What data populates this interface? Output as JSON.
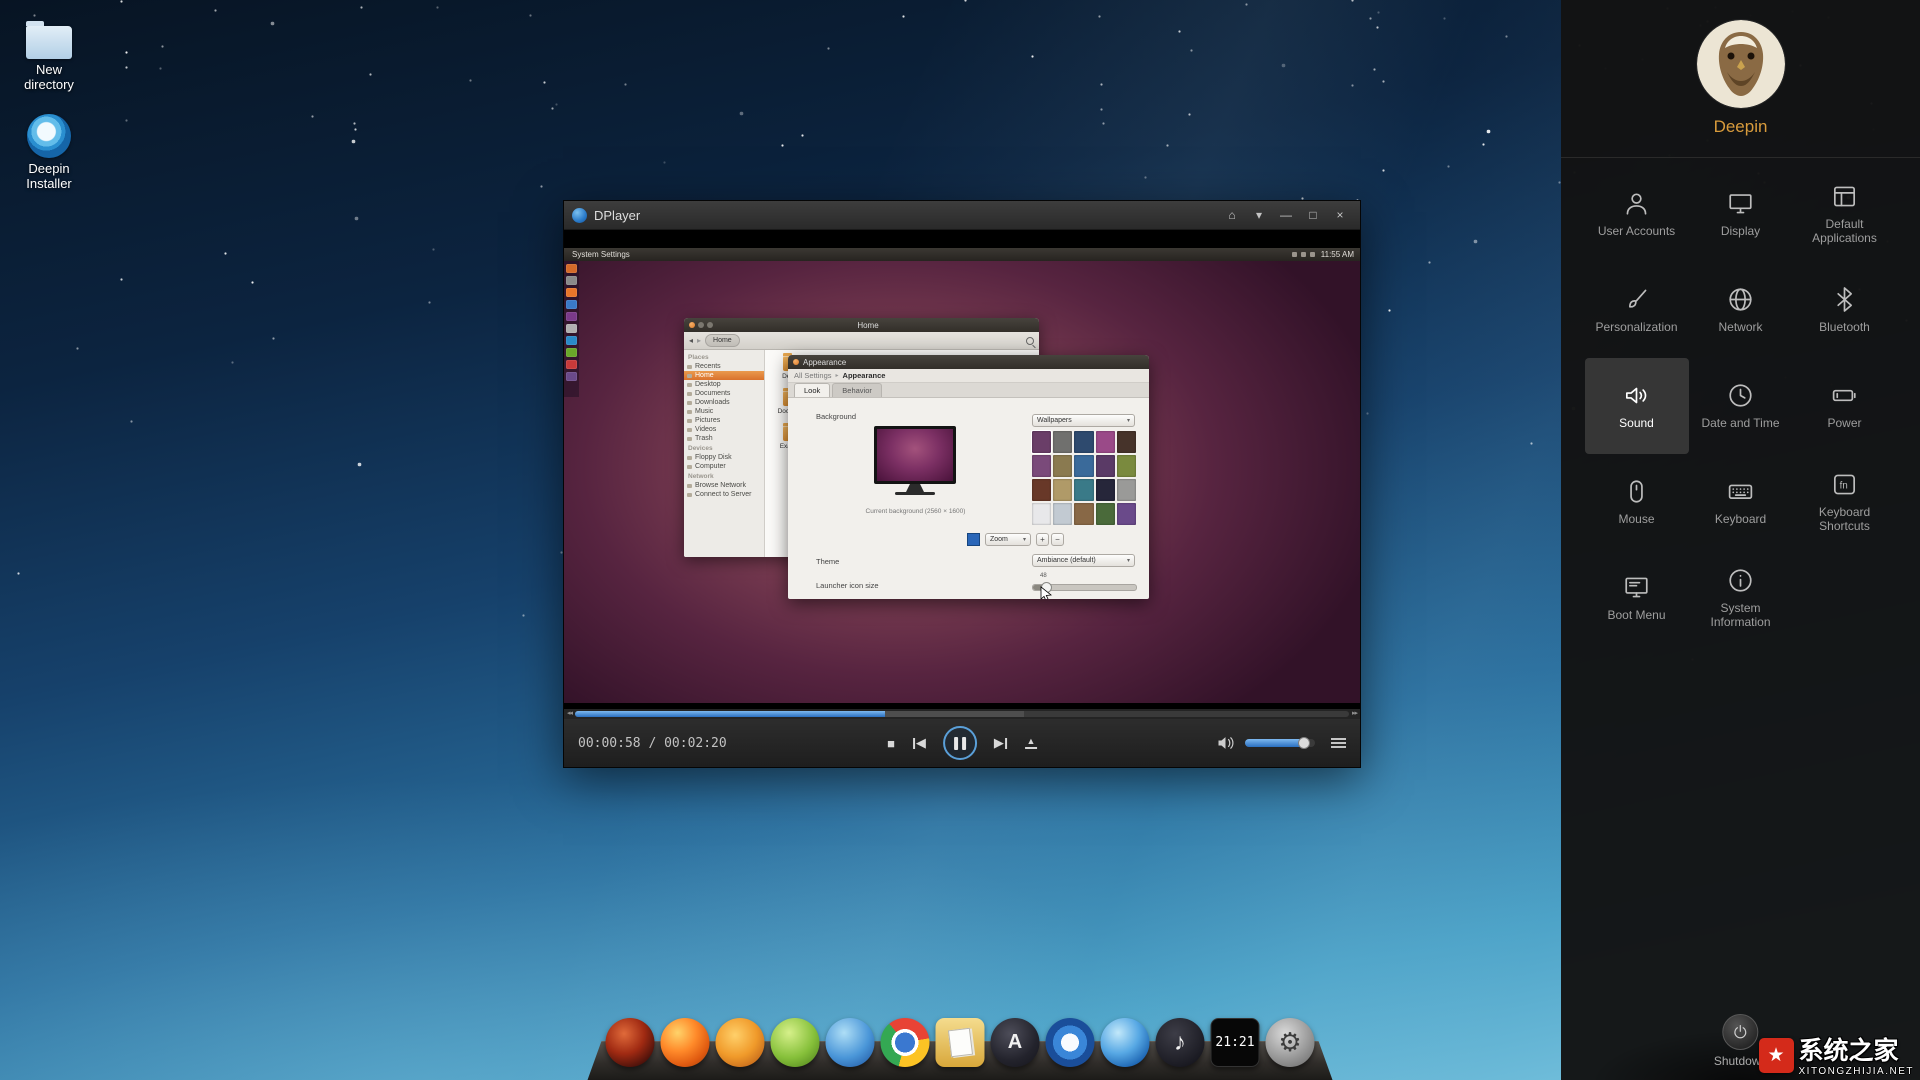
{
  "colors": {
    "selection_blue": "#4a90d9",
    "deepin_orange": "#d89b3c",
    "watermark_red": "#d42a1a",
    "sky_top": "#071423",
    "sky_bottom": "#7ec8e2"
  },
  "desktop": {
    "icons": [
      {
        "label": "New directory"
      },
      {
        "label": "Deepin Installer"
      }
    ]
  },
  "dplayer": {
    "title": "DPlayer",
    "titlebar_buttons": [
      {
        "name": "mini-mode-icon",
        "glyph": "⌂"
      },
      {
        "name": "menu-icon",
        "glyph": "▾"
      },
      {
        "name": "minimize-icon",
        "glyph": "—"
      },
      {
        "name": "maximize-icon",
        "glyph": "□"
      },
      {
        "name": "close-icon",
        "glyph": "×"
      }
    ],
    "time_display": "00:00:58 / 00:02:20",
    "progress_percent": 40,
    "buffer_percent": 58,
    "volume_percent": 84,
    "seek_icons": {
      "back": "◂◂",
      "forward": "▸▸"
    },
    "controls": {
      "stop": "■",
      "previous": "◀",
      "next": "▶",
      "eject": "▲"
    },
    "video": {
      "menubar": {
        "app_name": "System Settings",
        "clock": "11:55 AM"
      },
      "launcher_colors": [
        "#d46a2a",
        "#8a8a8a",
        "#e8762a",
        "#3a7ac8",
        "#7a3a8a",
        "#b0b0b0",
        "#2a8ac8",
        "#6aa82a",
        "#c83a3a",
        "#6a4a8a"
      ],
      "file_manager": {
        "title": "Home",
        "places_header": "Places",
        "places": [
          "Recents",
          "Home",
          "Desktop",
          "Documents",
          "Downloads",
          "Music",
          "Pictures",
          "Videos",
          "Trash"
        ],
        "devices_header": "Devices",
        "devices": [
          "Floppy Disk",
          "Computer"
        ],
        "network_header": "Network",
        "network": [
          "Browse Network",
          "Connect to Server"
        ],
        "selected": "Home",
        "folders": [
          "Desktop",
          "Documents",
          "Examples"
        ]
      },
      "appearance": {
        "title": "Appearance",
        "breadcrumb_all": "All Settings",
        "breadcrumb_sep": "▸",
        "breadcrumb_current": "Appearance",
        "tabs": [
          "Look",
          "Behavior"
        ],
        "background_label": "Background",
        "current_background": "Current background (2560 × 1600)",
        "zoom_label": "Zoom",
        "dropdown_arrow": "▾",
        "add_button": "+",
        "remove_button": "−",
        "wallpapers_label": "Wallpapers",
        "theme_label": "Theme",
        "theme_value": "Ambiance (default)",
        "launcher_label": "Launcher icon size",
        "launcher_value": "48",
        "launcher_slider_percent": 12,
        "thumbs": [
          "#6a3e68",
          "#70706e",
          "#2e4a6e",
          "#9a4a88",
          "#46332a",
          "#7a4a7a",
          "#8a7a50",
          "#3a6a9a",
          "#5a3a66",
          "#7a8a3e",
          "#683828",
          "#b09a68",
          "#3a7a88",
          "#26263a",
          "#9a9a98",
          "#e8e8ea",
          "#c2cad2",
          "#886846",
          "#4a6a3a",
          "#6a4a8a"
        ]
      }
    }
  },
  "control_center": {
    "user_name": "Deepin",
    "modules": [
      {
        "label": "User Accounts"
      },
      {
        "label": "Display"
      },
      {
        "label": "Default Applications"
      },
      {
        "label": "Personalization"
      },
      {
        "label": "Network"
      },
      {
        "label": "Bluetooth"
      },
      {
        "label": "Sound",
        "selected": true
      },
      {
        "label": "Date and Time"
      },
      {
        "label": "Power"
      },
      {
        "label": "Mouse"
      },
      {
        "label": "Keyboard"
      },
      {
        "label": "Keyboard Shortcuts"
      },
      {
        "label": "Boot Menu"
      },
      {
        "label": "System Information"
      }
    ],
    "shutdown_label": "Shutdown"
  },
  "dock": {
    "clock": "21:21",
    "apps": [
      {
        "name": "media-red",
        "color": "#a02a12"
      },
      {
        "name": "firefox",
        "color": "#ff8a2a"
      },
      {
        "name": "software-orange",
        "color": "#f09a2a"
      },
      {
        "name": "media-green",
        "color": "#86c03a"
      },
      {
        "name": "globe-blue",
        "color": "#4a96d8"
      },
      {
        "name": "chrome",
        "color": "#e84335"
      },
      {
        "name": "files",
        "color": "#d8a73a"
      },
      {
        "name": "steam",
        "glyph": "A",
        "color": "#23232c"
      },
      {
        "name": "ring-blue",
        "color": "#3a86d8"
      },
      {
        "name": "swirl-blue",
        "color": "#57a8e4"
      },
      {
        "name": "music-dark",
        "glyph": "♪",
        "color": "#1c1c24"
      },
      {
        "name": "clock",
        "color": "#070707"
      },
      {
        "name": "gear-gray",
        "glyph": "⚙",
        "color": "#9a9a9a"
      }
    ]
  },
  "watermark": {
    "logo_glyph": "★",
    "title": "系统之家",
    "subtitle": "XITONGZHIJIA.NET"
  }
}
